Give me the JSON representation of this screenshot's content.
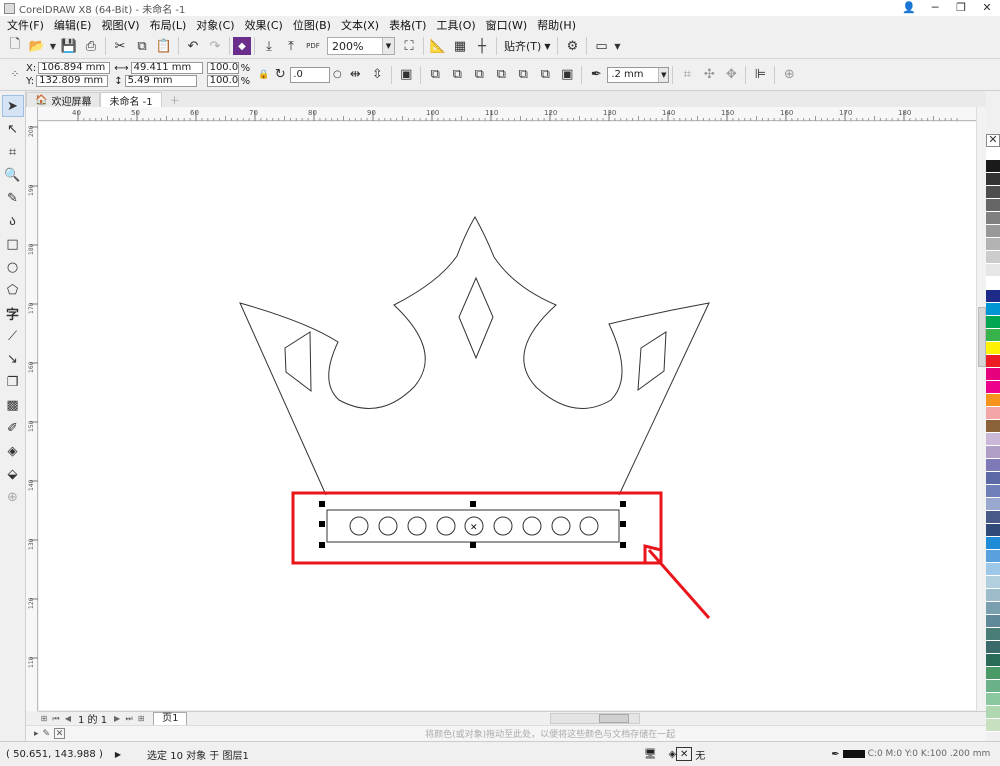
{
  "window": {
    "title": "CorelDRAW X8 (64-Bit) - 未命名 -1"
  },
  "menu": [
    "文件(F)",
    "编辑(E)",
    "视图(V)",
    "布局(L)",
    "对象(C)",
    "效果(C)",
    "位图(B)",
    "文本(X)",
    "表格(T)",
    "工具(O)",
    "窗口(W)",
    "帮助(H)"
  ],
  "toolbar": {
    "zoom": "200%",
    "snap_label": "贴齐(T)",
    "pdf_label": "PDF"
  },
  "props": {
    "x": "106.894 mm",
    "y": "132.809 mm",
    "w": "49.411 mm",
    "h": "5.49 mm",
    "sx": "100.0",
    "sy": "100.0",
    "pct": "%",
    "rotation": ".0",
    "outline": ".2 mm",
    "xlabel": "X:",
    "ylabel": "Y:"
  },
  "tabs": {
    "welcome": "欢迎屏幕",
    "doc": "未命名 -1"
  },
  "ruler": {
    "h_ticks": [
      "40",
      "50",
      "60",
      "70",
      "80",
      "90",
      "100",
      "110",
      "120",
      "130",
      "140",
      "150",
      "160",
      "170",
      "180"
    ],
    "v_ticks": [
      "200",
      "190",
      "180",
      "170",
      "160",
      "150",
      "140",
      "130",
      "120",
      "110"
    ],
    "unit": "毫米"
  },
  "pagenav": {
    "count": "1 的 1",
    "page": "页1"
  },
  "hint": "将颜色(或对象)拖动至此处，以便将这些颜色与文档存储在一起",
  "status": {
    "coords": "( 50.651, 143.988 )",
    "selection": "选定 10 对象 于 图层1",
    "fill_none": "无",
    "outline_info": "C:0 M:0 Y:0 K:100  .200 mm"
  },
  "palette": [
    "#ffffff",
    "#1a1a1a",
    "#333333",
    "#4d4d4d",
    "#666666",
    "#808080",
    "#999999",
    "#b3b3b3",
    "#cccccc",
    "#e6e6e6",
    "#ffffff",
    "#1e2a87",
    "#0096d6",
    "#00a651",
    "#38b24a",
    "#fff200",
    "#ed1c24",
    "#e6007e",
    "#ec008c",
    "#f7941d",
    "#f4a6a6",
    "#8c6239",
    "#c9b8d8",
    "#b0a0c8",
    "#7e7ab8",
    "#5e6aa8",
    "#6f7fb8",
    "#9aa8d0",
    "#4a5a88",
    "#2f4a78",
    "#1f8ad6",
    "#5aa0dc",
    "#9ec8e8",
    "#b0d0e0",
    "#9bbcc8",
    "#7aa0b0",
    "#5f8898",
    "#4a7c78",
    "#3a6a6a",
    "#2a6a58",
    "#4a9a68",
    "#6ab088",
    "#8ac8a0",
    "#b0d8b0",
    "#c8e0c0"
  ]
}
